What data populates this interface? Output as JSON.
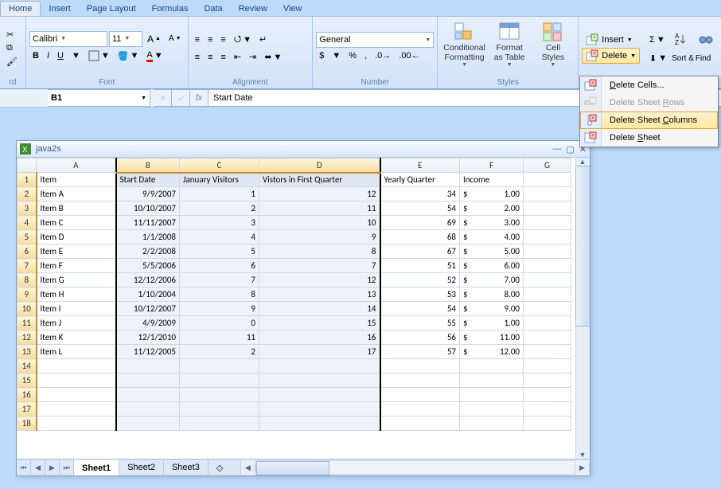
{
  "tabs": [
    "Home",
    "Insert",
    "Page Layout",
    "Formulas",
    "Data",
    "Review",
    "View"
  ],
  "active_tab": "Home",
  "ribbon": {
    "clipboard_label": "rd",
    "font": {
      "name": "Calibri",
      "size": "11",
      "label": "Font",
      "bold": "B",
      "italic": "I",
      "underline": "U"
    },
    "alignment_label": "Alignment",
    "number": {
      "format": "General",
      "label": "Number",
      "currency": "$",
      "percent": "%",
      "comma": ","
    },
    "styles": {
      "conditional": "Conditional\nFormatting",
      "format_table": "Format\nas Table",
      "cell_styles": "Cell\nStyles",
      "label": "Styles"
    },
    "cells": {
      "insert": "Insert",
      "delete": "Delete"
    },
    "editing": {
      "sort": "Sort &",
      "find": "Find"
    }
  },
  "delete_menu": {
    "delete_cells": "Delete Cells...",
    "delete_sheet_rows": "Delete Sheet Rows",
    "delete_sheet_columns": "Delete Sheet Columns",
    "delete_sheet": "Delete Sheet",
    "highlighted": "delete_sheet_columns",
    "disabled": "delete_sheet_rows"
  },
  "formula_bar": {
    "name_box": "B1",
    "fx": "fx",
    "value": "Start Date"
  },
  "workbook": {
    "title": "java2s",
    "sheets": [
      "Sheet1",
      "Sheet2",
      "Sheet3"
    ],
    "active_sheet": "Sheet1",
    "columns": [
      "A",
      "B",
      "C",
      "D",
      "E",
      "F",
      "G"
    ],
    "selected_cols": [
      "B",
      "C",
      "D"
    ],
    "headers": {
      "A": "Item",
      "B": "Start Date",
      "C": "January Visitors",
      "D": "Vistors in First Quarter",
      "E": "Yearly Quarter",
      "F": "Income"
    },
    "rows": [
      {
        "A": "Item A",
        "B": "9/9/2007",
        "C": "1",
        "D": "12",
        "E": "34",
        "F_pre": "$",
        "F": "1.00"
      },
      {
        "A": "Item B",
        "B": "10/10/2007",
        "C": "2",
        "D": "11",
        "E": "54",
        "F_pre": "$",
        "F": "2.00"
      },
      {
        "A": "Item C",
        "B": "11/11/2007",
        "C": "3",
        "D": "10",
        "E": "69",
        "F_pre": "$",
        "F": "3.00"
      },
      {
        "A": "Item D",
        "B": "1/1/2008",
        "C": "4",
        "D": "9",
        "E": "68",
        "F_pre": "$",
        "F": "4.00"
      },
      {
        "A": "Item E",
        "B": "2/2/2008",
        "C": "5",
        "D": "8",
        "E": "67",
        "F_pre": "$",
        "F": "5.00"
      },
      {
        "A": "Item F",
        "B": "5/5/2006",
        "C": "6",
        "D": "7",
        "E": "51",
        "F_pre": "$",
        "F": "6.00"
      },
      {
        "A": "Item G",
        "B": "12/12/2006",
        "C": "7",
        "D": "12",
        "E": "52",
        "F_pre": "$",
        "F": "7.00"
      },
      {
        "A": "Item H",
        "B": "1/10/2004",
        "C": "8",
        "D": "13",
        "E": "53",
        "F_pre": "$",
        "F": "8.00"
      },
      {
        "A": "Item I",
        "B": "10/12/2007",
        "C": "9",
        "D": "14",
        "E": "54",
        "F_pre": "$",
        "F": "9.00"
      },
      {
        "A": "Item J",
        "B": "4/9/2009",
        "C": "0",
        "D": "15",
        "E": "55",
        "F_pre": "$",
        "F": "1.00"
      },
      {
        "A": "Item K",
        "B": "12/1/2010",
        "C": "11",
        "D": "16",
        "E": "56",
        "F_pre": "$",
        "F": "11.00"
      },
      {
        "A": "Item L",
        "B": "11/12/2005",
        "C": "2",
        "D": "17",
        "E": "57",
        "F_pre": "$",
        "F": "12.00"
      }
    ],
    "empty_rows": [
      14,
      15,
      16,
      17,
      18
    ]
  }
}
